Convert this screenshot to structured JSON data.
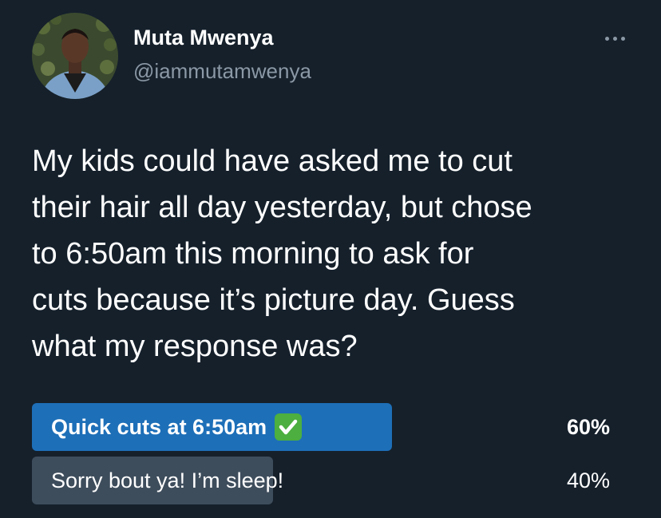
{
  "tweet": {
    "author": {
      "display_name": "Muta Mwenya",
      "handle": "@iammutamwenya",
      "avatar_icon": "profile-photo"
    },
    "more_icon": "more-horizontal-icon",
    "text_lines": [
      "My kids could have asked me to cut",
      "their hair all day yesterday, but chose",
      "to 6:50am this morning to ask for",
      "cuts because it’s picture day. Guess",
      "what my response was?"
    ]
  },
  "poll": {
    "options": [
      {
        "label": "Quick cuts at 6:50am",
        "percent_text": "60%",
        "share": 0.6,
        "winner": true,
        "emoji": "check-mark-button-icon"
      },
      {
        "label": "Sorry bout ya! I’m sleep!",
        "percent_text": "40%",
        "share": 0.4,
        "winner": false
      }
    ]
  },
  "colors": {
    "background": "#15202b",
    "winner_fill": "#1d6fb8",
    "other_fill": "#3e4d5c",
    "secondary_text": "#8b98a5"
  }
}
